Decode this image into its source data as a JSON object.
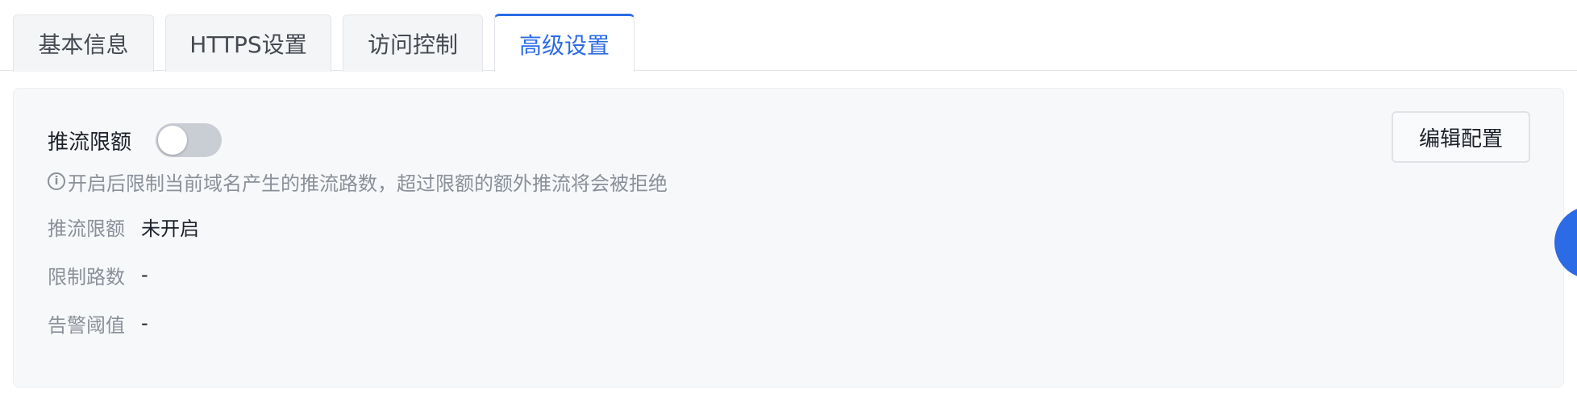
{
  "tabs": [
    {
      "label": "基本信息",
      "active": false
    },
    {
      "label": "HTTPS设置",
      "active": false
    },
    {
      "label": "访问控制",
      "active": false
    },
    {
      "label": "高级设置",
      "active": true
    }
  ],
  "panel": {
    "toggle_label": "推流限额",
    "toggle_on": false,
    "hint_icon": "info-icon",
    "hint": "开启后限制当前域名产生的推流路数，超过限额的额外推流将会被拒绝",
    "fields": [
      {
        "key": "推流限额",
        "value": "未开启"
      },
      {
        "key": "限制路数",
        "value": "-"
      },
      {
        "key": "告警阈值",
        "value": "-"
      }
    ],
    "edit_button": "编辑配置"
  },
  "colors": {
    "accent": "#2b6be6",
    "panel_bg": "#f7f8fa",
    "muted_text": "#8a9099",
    "switch_off": "#c9cdd4"
  }
}
